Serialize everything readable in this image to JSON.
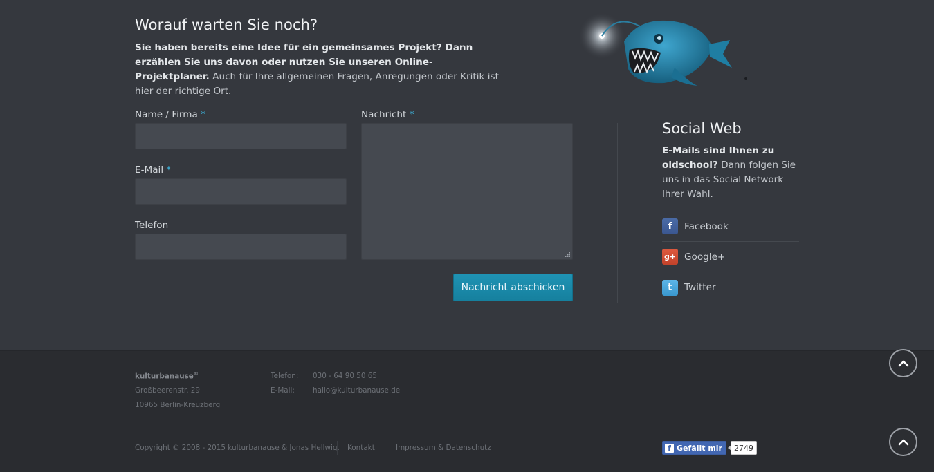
{
  "intro": {
    "title": "Worauf warten Sie noch?",
    "text_bold": "Sie haben bereits eine Idee für ein gemeinsames Projekt? Dann erzählen Sie uns davon oder nutzen Sie unseren Online-Projektplaner.",
    "text_rest": " Auch für Ihre allgemeinen Fragen, Anregungen oder Kritik ist hier der richtige Ort."
  },
  "form": {
    "name_label": "Name / Firma",
    "email_label": "E-Mail",
    "phone_label": "Telefon",
    "message_label": "Nachricht",
    "required_mark": "*",
    "name_value": "",
    "email_value": "",
    "phone_value": "",
    "message_value": "",
    "submit_label": "Nachricht abschicken"
  },
  "social": {
    "title": "Social Web",
    "text_bold": "E-Mails sind Ihnen zu oldschool?",
    "text_rest": " Dann folgen Sie uns in das Social Network Ihrer Wahl.",
    "items": [
      {
        "label": "Facebook",
        "icon": "facebook-icon",
        "glyph": "f"
      },
      {
        "label": "Google+",
        "icon": "google-plus-icon",
        "glyph": "g+"
      },
      {
        "label": "Twitter",
        "icon": "twitter-icon",
        "glyph": "t"
      }
    ]
  },
  "footer": {
    "brand": "kulturbanause",
    "brand_mark": "®",
    "street": "Großbeerenstr. 29",
    "city": "10965 Berlin-Kreuzberg",
    "phone_label": "Telefon:",
    "phone_value": "030 - 64 90 50 65",
    "email_label": "E-Mail:",
    "email_value": "hallo@kulturbanause.de",
    "copyright": "Copyright © 2008 - 2015 kulturbanause & Jonas Hellwig.",
    "links": [
      "Kontakt",
      "Impressum & Datenschutz"
    ],
    "like_label": "Gefällt mir",
    "like_count": "2749"
  },
  "colors": {
    "accent": "#1a8aab",
    "required": "#3db6e0",
    "background": "#35383e",
    "footer_background": "#2a2c30"
  }
}
